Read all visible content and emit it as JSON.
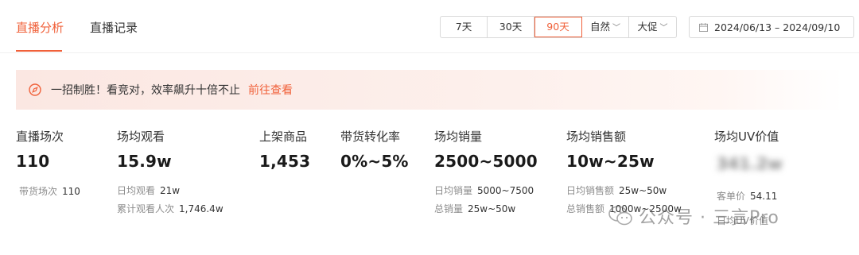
{
  "tabs": [
    {
      "label": "直播分析",
      "active": true
    },
    {
      "label": "直播记录",
      "active": false
    }
  ],
  "filters": {
    "ranges": [
      "7天",
      "30天",
      "90天"
    ],
    "active_range": "90天",
    "dropdowns": [
      "自然",
      "大促"
    ],
    "date_range": "2024/06/13 – 2024/09/10"
  },
  "banner": {
    "text": "一招制胜！看竞对，效率飙升十倍不止",
    "link": "前往查看"
  },
  "metrics": [
    {
      "label": "直播场次",
      "value": "110",
      "subs": [
        {
          "label": "带货场次",
          "value": "110"
        }
      ]
    },
    {
      "label": "场均观看",
      "value": "15.9w",
      "subs": [
        {
          "label": "日均观看",
          "value": "21w"
        },
        {
          "label": "累计观看人次",
          "value": "1,746.4w"
        }
      ]
    },
    {
      "label": "上架商品",
      "value": "1,453",
      "subs": []
    },
    {
      "label": "带货转化率",
      "value": "0%~5%",
      "subs": []
    },
    {
      "label": "场均销量",
      "value": "2500~5000",
      "subs": [
        {
          "label": "日均销量",
          "value": "5000~7500"
        },
        {
          "label": "总销量",
          "value": "25w~50w"
        }
      ]
    },
    {
      "label": "场均销售额",
      "value": "10w~25w",
      "subs": [
        {
          "label": "日均销售额",
          "value": "25w~50w"
        },
        {
          "label": "总销售额",
          "value": "1000w~2500w"
        }
      ]
    },
    {
      "label": "场均UV价值",
      "value": "341.2w",
      "value_blurred": true,
      "subs": [
        {
          "label": "客单价",
          "value": "54.11"
        },
        {
          "label": "日均UV价值",
          "value": ""
        }
      ]
    }
  ],
  "watermark": {
    "text": "公众号 · 三言Pro",
    "icon": "wechat-icon"
  },
  "colors": {
    "accent": "#f0613a"
  }
}
